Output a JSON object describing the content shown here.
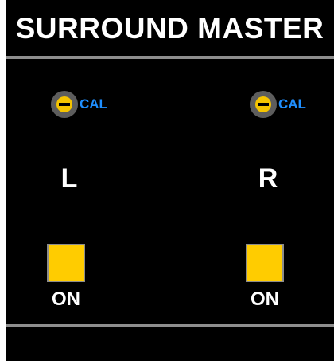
{
  "panel": {
    "title": "SURROUND MASTER"
  },
  "channels": [
    {
      "id": "left",
      "cal_label": "CAL",
      "cal_icon": "calibration-screw-icon",
      "letter": "L",
      "button_label": "ON",
      "button_state": "on"
    },
    {
      "id": "right",
      "cal_label": "CAL",
      "cal_icon": "calibration-screw-icon",
      "letter": "R",
      "button_label": "ON",
      "button_state": "on"
    }
  ],
  "colors": {
    "background": "#000000",
    "divider": "#8e8e8e",
    "cal_label": "#1f8fff",
    "button_lit": "#ffcc00",
    "screw_body": "#5d5d5d",
    "screw_head": "#f5c400"
  }
}
